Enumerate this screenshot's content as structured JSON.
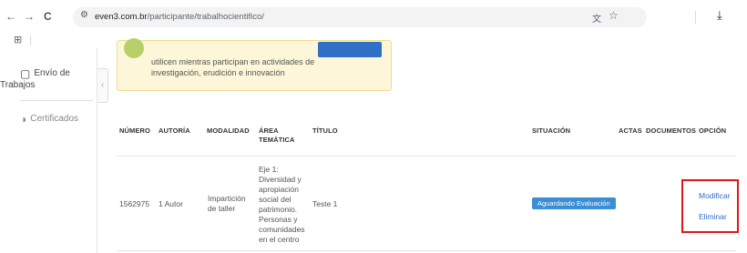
{
  "browser": {
    "url_domain": "even3.com.br",
    "url_path": "/participante/trabalhocientifico/",
    "back_icon": "←",
    "forward_icon": "→",
    "reload_icon": "C",
    "site_settings_icon": "⚙",
    "translate_icon": "文",
    "star_icon": "☆",
    "download_icon": "⤓",
    "apps_icon": "⊞"
  },
  "sidebar": {
    "items": [
      {
        "label_line1": "Envío de",
        "label_line2": "Trabajos",
        "icon": "▢"
      },
      {
        "label": "Certificados",
        "icon": "◑"
      }
    ],
    "collapse_icon": "‹"
  },
  "notice": {
    "line1": "utilicen mientras participan en actividades de",
    "line2": "investigación, erudición e innovación"
  },
  "table": {
    "headers": {
      "numero": "NÚMERO",
      "autoria": "AUTORÍA",
      "modalidad": "MODALIDAD",
      "area_line1": "ÁREA",
      "area_line2": "TEMÁTICA",
      "titulo": "TÍTULO",
      "situacion": "SITUACIÓN",
      "actas": "ACTAS",
      "documentos": "DOCUMENTOS",
      "opcion": "OPCIÓN"
    },
    "row": {
      "numero": "1562975",
      "autoria": "1 Autor",
      "modalidad_line1": "Impartición",
      "modalidad_line2": "de taller",
      "area_lines": [
        "Eje 1:",
        "Diversidad y",
        "apropiación",
        "social del",
        "patrimonio.",
        "Personas y",
        "comunidades",
        "en el centro"
      ],
      "titulo": "Teste 1",
      "situacion": "Aguardando Evaluación",
      "modificar": "Modificar",
      "eliminar": "Eliminar"
    }
  }
}
